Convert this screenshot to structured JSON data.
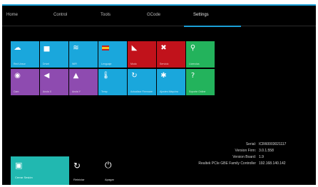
{
  "nav": {
    "tabs": [
      "Home",
      "Control",
      "Tools",
      "GCode",
      "Settings"
    ],
    "active": "Settings"
  },
  "tiles_row1": [
    {
      "icon": "cloud-icon",
      "glyph": "☁",
      "color": "#1aa7dc",
      "label": "Red Unsur"
    },
    {
      "icon": "folder-icon",
      "glyph": "▅",
      "color": "#1aa7dc",
      "label": "Drivel"
    },
    {
      "icon": "wifi-icon",
      "glyph": "≋",
      "color": "#1aa7dc",
      "label": "WiFi"
    },
    {
      "icon": "flag-icon",
      "glyph": "",
      "color": "#1aa7dc",
      "label": "Lenguaje"
    },
    {
      "icon": "chart-icon",
      "glyph": "◣",
      "color": "#c1121b",
      "label": "Modo"
    },
    {
      "icon": "tools-icon",
      "glyph": "✖",
      "color": "#c1121b",
      "label": "Servicio"
    },
    {
      "icon": "key-icon",
      "glyph": "⚲",
      "color": "#23b35c",
      "label": "Licencias"
    }
  ],
  "tiles_row2": [
    {
      "icon": "camera-icon",
      "glyph": "◉",
      "color": "#8e4bb0",
      "label": "Cam"
    },
    {
      "icon": "axis-icon",
      "glyph": "◀",
      "color": "#8e4bb0",
      "label": "Ancla X"
    },
    {
      "icon": "axis-icon",
      "glyph": "▲",
      "color": "#8e4bb0",
      "label": "Ancla Y"
    },
    {
      "icon": "thermometer-icon",
      "glyph": "🌡",
      "color": "#1aa7dc",
      "label": "Temp"
    },
    {
      "icon": "refresh-icon",
      "glyph": "↻",
      "color": "#1aa7dc",
      "label": "Actualizar Firmware"
    },
    {
      "icon": "gear-icon",
      "glyph": "✱",
      "color": "#1aa7dc",
      "label": "Ajustes Máquina"
    },
    {
      "icon": "help-icon",
      "glyph": "?",
      "color": "#23b35c",
      "label": "Soporte Online"
    }
  ],
  "info": {
    "serial_label": "Serial:",
    "serial_value": "ICR60003021117",
    "firm_label": "Version Firm:",
    "firm_value": "3.0.1.558",
    "board_label": "Version Board:",
    "board_value": "1.9",
    "nic_label": "Realtek PCIe GBE Family Controller",
    "nic_value": "192.168.140.142"
  },
  "bottom": {
    "user_label": "Cerrar Sesión",
    "restart_label": "Reiniciar",
    "shutdown_label": "Apagar"
  }
}
